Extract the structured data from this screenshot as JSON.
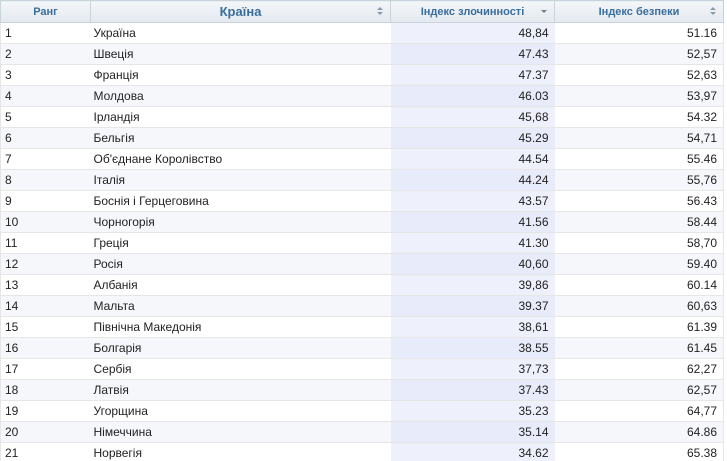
{
  "table": {
    "headers": {
      "rank": "Ранг",
      "country": "Країна",
      "crime_index": "Індекс злочинності",
      "safety_index": "Індекс безпеки"
    },
    "sorted_column": "crime_index",
    "sort_direction": "descending",
    "rows": [
      {
        "rank": "1",
        "country": "Україна",
        "crime": "48,84",
        "safety": "51.16"
      },
      {
        "rank": "2",
        "country": "Швеція",
        "crime": "47.43",
        "safety": "52,57"
      },
      {
        "rank": "3",
        "country": "Франція",
        "crime": "47.37",
        "safety": "52,63"
      },
      {
        "rank": "4",
        "country": "Молдова",
        "crime": "46.03",
        "safety": "53,97"
      },
      {
        "rank": "5",
        "country": "Ірландія",
        "crime": "45,68",
        "safety": "54.32"
      },
      {
        "rank": "6",
        "country": "Бельгія",
        "crime": "45.29",
        "safety": "54,71"
      },
      {
        "rank": "7",
        "country": "Об'єднане Королівство",
        "crime": "44.54",
        "safety": "55.46"
      },
      {
        "rank": "8",
        "country": "Італія",
        "crime": "44.24",
        "safety": "55,76"
      },
      {
        "rank": "9",
        "country": "Боснія і Герцеговина",
        "crime": "43.57",
        "safety": "56.43"
      },
      {
        "rank": "10",
        "country": "Чорногорія",
        "crime": "41.56",
        "safety": "58.44"
      },
      {
        "rank": "11",
        "country": "Греція",
        "crime": "41.30",
        "safety": "58,70"
      },
      {
        "rank": "12",
        "country": "Росія",
        "crime": "40,60",
        "safety": "59.40"
      },
      {
        "rank": "13",
        "country": "Албанія",
        "crime": "39,86",
        "safety": "60.14"
      },
      {
        "rank": "14",
        "country": "Мальта",
        "crime": "39.37",
        "safety": "60,63"
      },
      {
        "rank": "15",
        "country": "Північна Македонія",
        "crime": "38,61",
        "safety": "61.39"
      },
      {
        "rank": "16",
        "country": "Болгарія",
        "crime": "38.55",
        "safety": "61.45"
      },
      {
        "rank": "17",
        "country": "Сербія",
        "crime": "37,73",
        "safety": "62,27"
      },
      {
        "rank": "18",
        "country": "Латвія",
        "crime": "37.43",
        "safety": "62,57"
      },
      {
        "rank": "19",
        "country": "Угорщина",
        "crime": "35.23",
        "safety": "64,77"
      },
      {
        "rank": "20",
        "country": "Німеччина",
        "crime": "35.14",
        "safety": "64.86"
      },
      {
        "rank": "21",
        "country": "Норвегія",
        "crime": "34.62",
        "safety": "65.38"
      }
    ]
  },
  "colors": {
    "header_text": "#3a6e9c",
    "sorted_column_bg": "#eef0fc",
    "row_divider": "#e6e6e6"
  }
}
